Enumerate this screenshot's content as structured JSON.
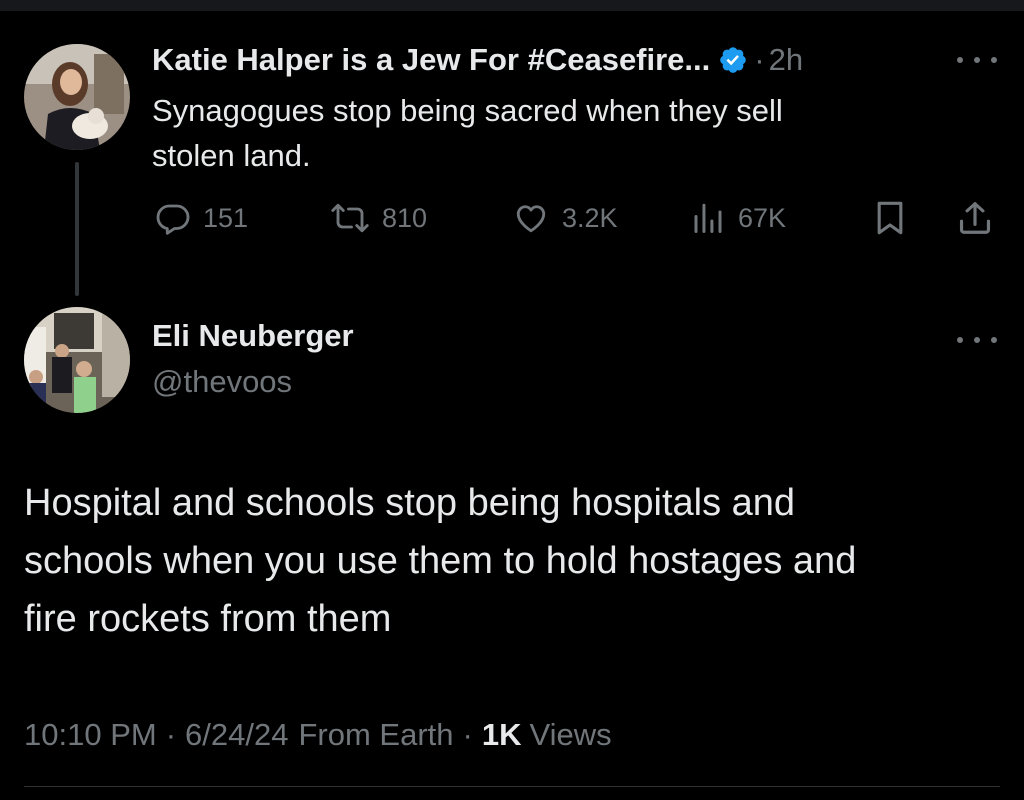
{
  "tweet1": {
    "author_name": "Katie Halper is a Jew For #Ceasefire...",
    "verified": true,
    "separator": "·",
    "time": "2h",
    "text_line1": "Synagogues stop being sacred when they sell",
    "text_line2": "stolen land.",
    "replies": "151",
    "retweets": "810",
    "likes": "3.2K",
    "views": "67K",
    "icons": [
      "reply-icon",
      "retweet-icon",
      "like-icon",
      "views-icon",
      "bookmark-icon",
      "share-icon",
      "more-icon",
      "verified-badge-icon"
    ]
  },
  "tweet2": {
    "author_name": "Eli Neuberger",
    "handle": "@thevoos",
    "text_line1": "Hospital and schools stop being hospitals and",
    "text_line2": "schools when you use them to hold hostages and",
    "text_line3": "fire rockets from them",
    "time": "10:10 PM",
    "date": "6/24/24",
    "source": "From Earth",
    "separator": "·",
    "views_count": "1K",
    "views_label": "Views"
  },
  "colors": {
    "background": "#000000",
    "primary_text": "#e7e9ea",
    "secondary_text": "#71767b",
    "verified_blue": "#1d9bf0"
  }
}
